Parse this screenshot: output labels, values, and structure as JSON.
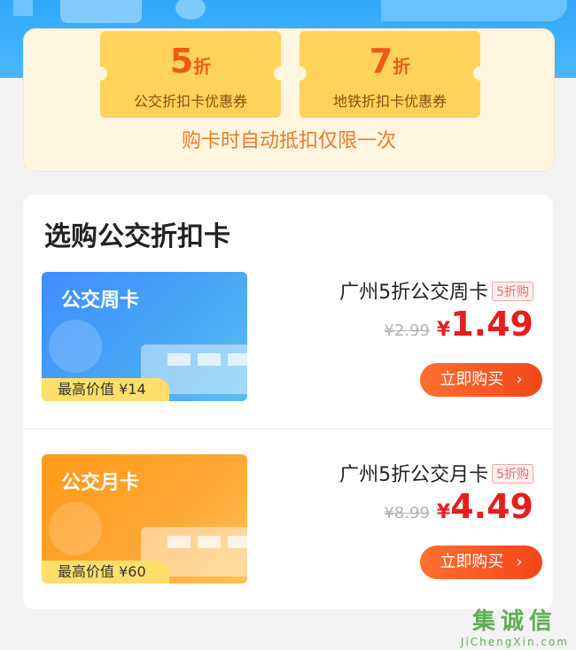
{
  "coupons": [
    {
      "discount": "5",
      "unit": "折",
      "caption": "公交折扣卡优惠券"
    },
    {
      "discount": "7",
      "unit": "折",
      "caption": "地铁折扣卡优惠券"
    }
  ],
  "coupon_note": "购卡时自动抵扣仅限一次",
  "section_title": "选购公交折扣卡",
  "products": [
    {
      "thumb_title": "公交周卡",
      "value_label": "最高价值 ¥14",
      "name": "广州5折公交周卡",
      "tag": "5折购",
      "old_price": "¥2.99",
      "currency": "¥",
      "price": "1.49",
      "buy_label": "立即购买"
    },
    {
      "thumb_title": "公交月卡",
      "value_label": "最高价值 ¥60",
      "name": "广州5折公交月卡",
      "tag": "5折购",
      "old_price": "¥8.99",
      "currency": "¥",
      "price": "4.49",
      "buy_label": "立即购买"
    }
  ],
  "watermark": {
    "cn": "集诚信",
    "en": "JiChengXin.com"
  },
  "colors": {
    "accent": "#f3461b",
    "price": "#e61e1e",
    "banner": "#32a8fb",
    "coupon": "#ffd35a"
  }
}
